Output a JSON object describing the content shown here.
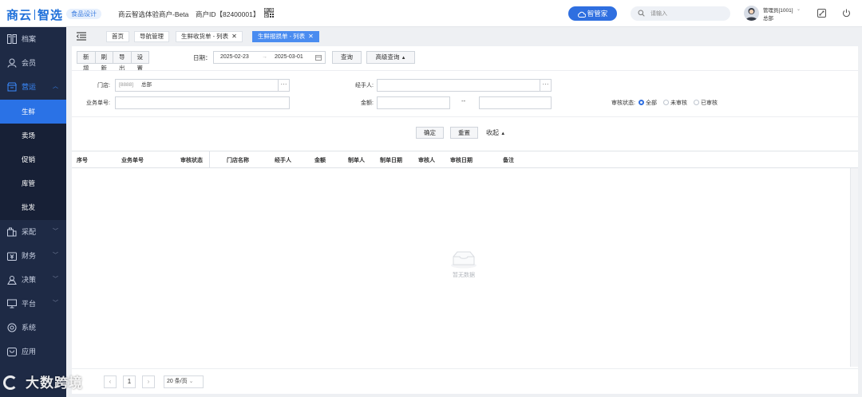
{
  "header": {
    "logo": "商云智选",
    "logo_parts": [
      "商云",
      "智选"
    ],
    "edition": "食品设计",
    "merchant": "商云智选体验商户-Beta",
    "merchant_id": "商户ID【82400001】",
    "steward_button": "智管家",
    "search_placeholder": "请输入",
    "user_name": "管理员[1001]",
    "user_store": "总部",
    "icons": {
      "qr": "qr-code-icon",
      "fullscreen": "fullscreen-icon",
      "power": "power-icon",
      "search": "search-icon"
    }
  },
  "sidebar": {
    "items": [
      {
        "label": "档案",
        "icon": "archive-icon"
      },
      {
        "label": "会员",
        "icon": "member-icon"
      },
      {
        "label": "营运",
        "icon": "store-icon",
        "expanded": true
      },
      {
        "label": "采配",
        "icon": "purchase-icon"
      },
      {
        "label": "财务",
        "icon": "finance-icon"
      },
      {
        "label": "决策",
        "icon": "decision-icon"
      },
      {
        "label": "平台",
        "icon": "platform-icon"
      },
      {
        "label": "系统",
        "icon": "system-icon"
      },
      {
        "label": "应用",
        "icon": "app-icon"
      }
    ],
    "subitems": [
      {
        "label": "生鲜",
        "active": true
      },
      {
        "label": "卖场"
      },
      {
        "label": "促销"
      },
      {
        "label": "库管"
      },
      {
        "label": "批发"
      }
    ]
  },
  "tabs": [
    {
      "label": "首页"
    },
    {
      "label": "导航管理"
    },
    {
      "label": "生鲜收货单 - 列表"
    },
    {
      "label": "生鲜报损单 - 列表",
      "active": true
    }
  ],
  "toolbar": {
    "buttons": [
      "新增",
      "刷新",
      "导出",
      "设置"
    ],
    "date_label": "日期：",
    "date_from": "2025-02-23",
    "date_to": "2025-03-01",
    "date_arrow": "→",
    "query": "查询",
    "advanced": "高级查询"
  },
  "filters": {
    "store_label": "门店:",
    "store_code": "[8888]",
    "store_name": "总部",
    "handler_label": "经手人:",
    "doc_no_label": "业务单号:",
    "amount_label": "金额:",
    "amount_sep": "--",
    "audit_label": "审核状态:",
    "audit_options": [
      "全部",
      "未审核",
      "已审核"
    ],
    "audit_selected": "全部",
    "dots": "···"
  },
  "actions": {
    "confirm": "确定",
    "reset": "重置",
    "fold": "收起"
  },
  "table": {
    "columns": [
      "序号",
      "业务单号",
      "审核状态",
      "门店名称",
      "经手人",
      "金额",
      "制单人",
      "制单日期",
      "审核人",
      "审核日期",
      "备注"
    ],
    "rows": [],
    "empty_text": "暂无数据"
  },
  "pagination": {
    "page": "1",
    "page_size": "20 条/页"
  },
  "watermark": "大数跨境",
  "colors": {
    "primary": "#2f6fe0",
    "sidebar_bg": "#1e2a45",
    "active_sub": "#2a72e6",
    "active_tab": "#4a8cf0"
  }
}
